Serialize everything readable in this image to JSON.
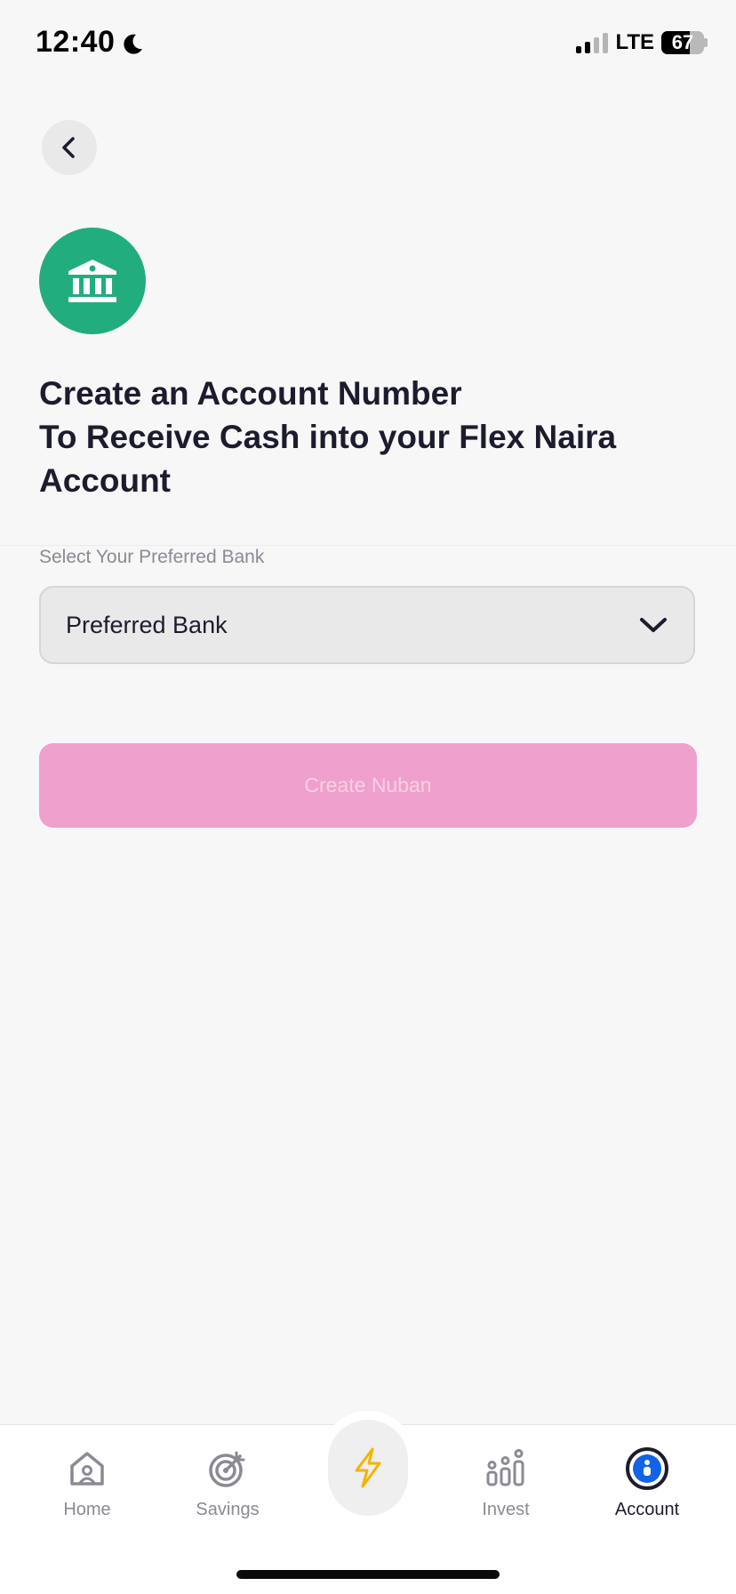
{
  "status_bar": {
    "time": "12:40",
    "network": "LTE",
    "battery": "67",
    "moon_icon": "moon-icon",
    "signal_icon": "cellular-signal-icon",
    "battery_icon": "battery-icon"
  },
  "header": {
    "back_icon": "chevron-left-icon",
    "badge_icon": "bank-building-icon",
    "badge_color": "#22ad7f"
  },
  "main": {
    "title": "Create an Account Number\nTo Receive Cash into your Flex Naira Account",
    "bank_field": {
      "label": "Select Your Preferred Bank",
      "value": "Preferred Bank",
      "icon": "chevron-down-icon"
    },
    "create_button": {
      "label": "Create Nuban",
      "color": "#f0a0cc"
    }
  },
  "tab_bar": {
    "items": [
      {
        "label": "Home",
        "icon": "home-icon",
        "active": false
      },
      {
        "label": "Savings",
        "icon": "target-icon",
        "active": false
      },
      {
        "label": "Invest",
        "icon": "invest-icon",
        "active": false
      },
      {
        "label": "Account",
        "icon": "account-icon",
        "active": true
      }
    ],
    "center_icon": "lightning-icon",
    "active_color": "#1c1c2e",
    "inactive_color": "#8a8a94",
    "lightning_color": "#f5b400"
  }
}
